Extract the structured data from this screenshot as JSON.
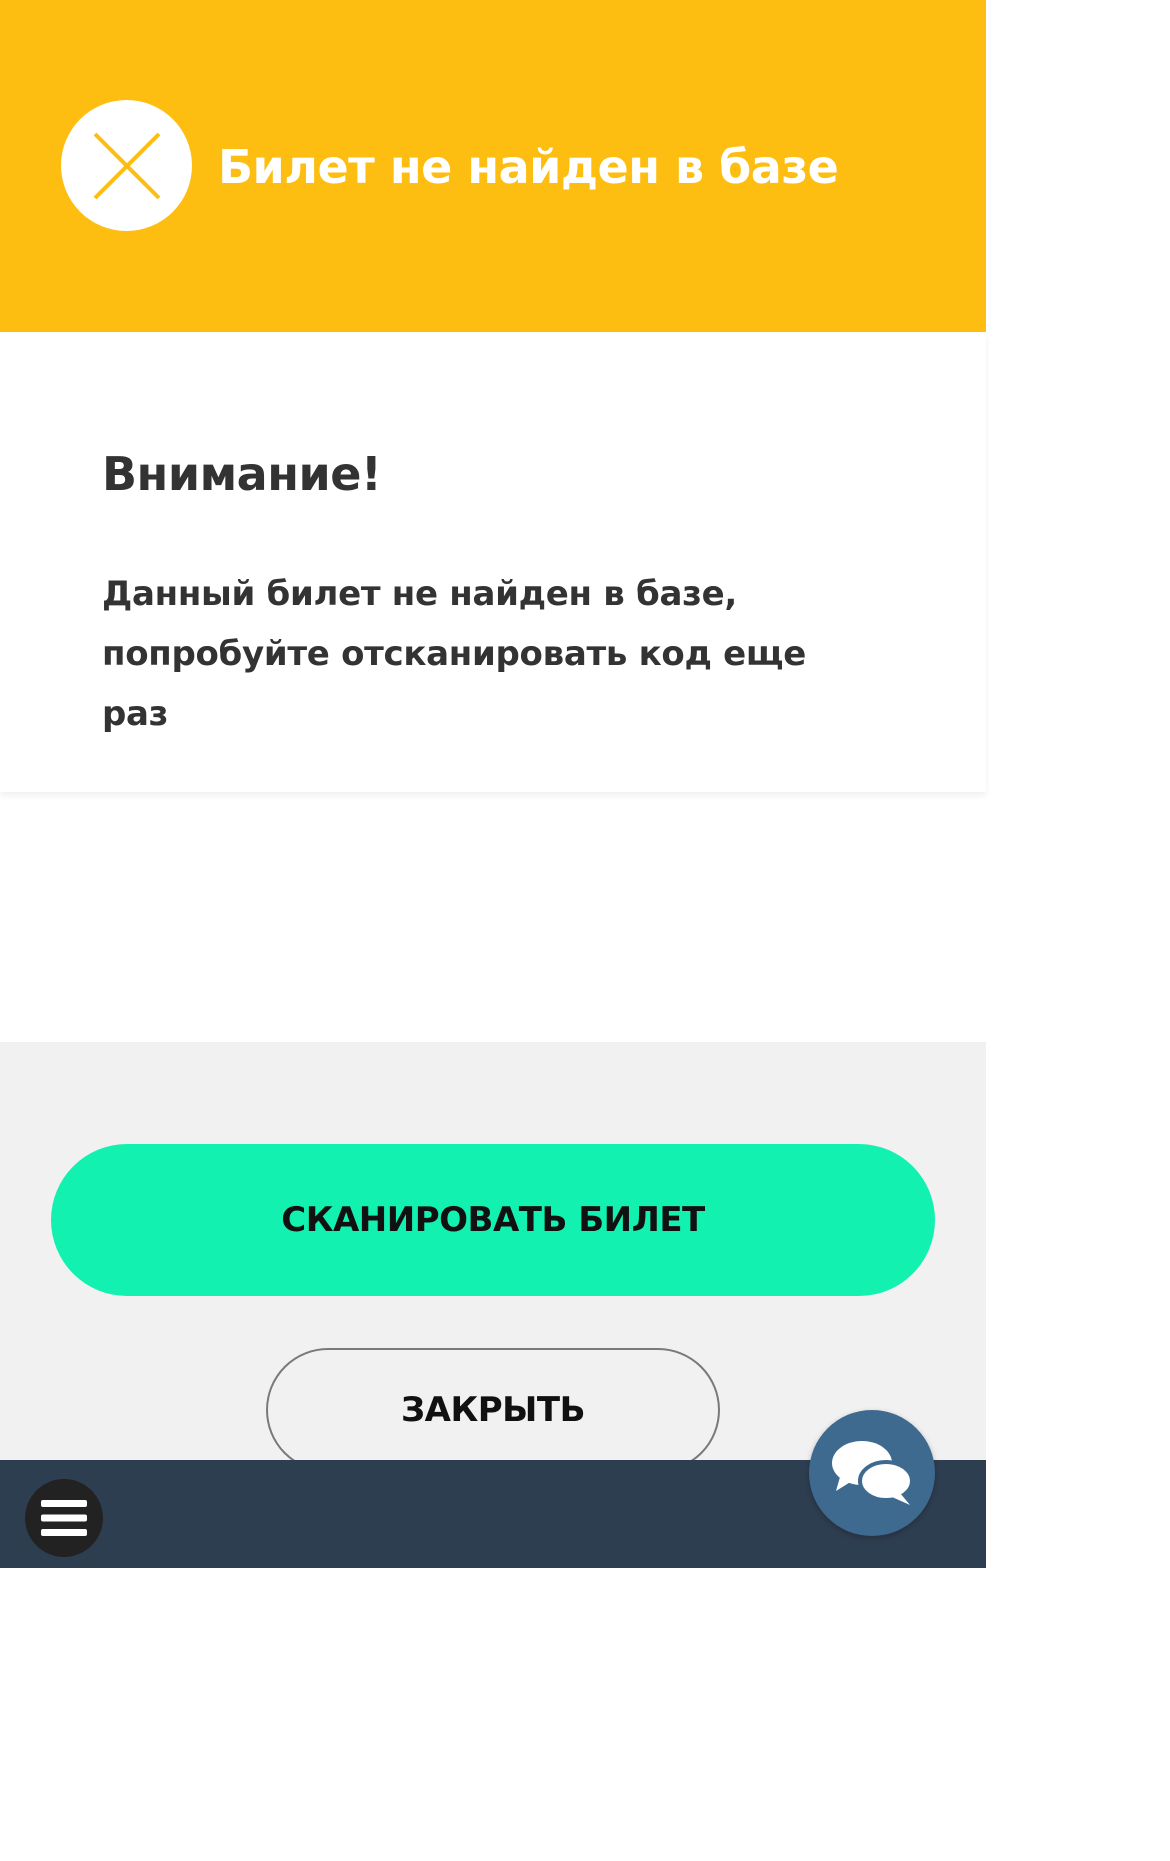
{
  "header": {
    "status_title": "Билет не найден в базе",
    "status_icon": "close-x-icon",
    "background_color": "#fdbd11"
  },
  "message": {
    "heading": "Внимание!",
    "body": "Данный билет не найден в базе, попробуйте отсканировать код еще раз"
  },
  "actions": {
    "scan_label": "СКАНИРОВАТЬ БИЛЕТ",
    "close_label": "ЗАКРЫТЬ",
    "scan_color": "#13f1b0"
  },
  "bottom_bar": {
    "menu_icon": "hamburger-menu-icon",
    "chat_icon": "chat-bubbles-icon",
    "background_color": "#2e3e51"
  }
}
